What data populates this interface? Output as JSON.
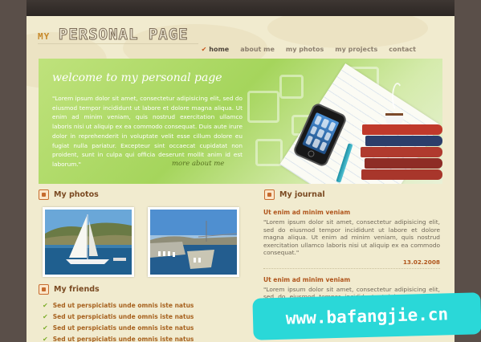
{
  "site": {
    "logo_small": "MY",
    "logo_main": "PERSONAL PAGE"
  },
  "nav": {
    "items": [
      "home",
      "about me",
      "my photos",
      "my projects",
      "contact"
    ],
    "active": "home"
  },
  "hero": {
    "title": "welcome to my personal page",
    "text": "\"Lorem ipsum dolor sit amet, consectetur adipisicing elit, sed do eiusmod tempor incididunt ut labore et dolore magna aliqua. Ut enim ad minim veniam, quis nostrud exercitation ullamco laboris nisi ut aliquip ex ea commodo consequat. Duis aute irure dolor in reprehenderit in voluptate velit esse cillum dolore eu fugiat nulla pariatur. Excepteur sint occaecat cupidatat non proident, sunt in culpa qui officia deserunt mollit anim id est laborum.\"",
    "more_link": "more about me"
  },
  "photos": {
    "title": "My photos"
  },
  "friends": {
    "title": "My friends",
    "items": [
      "Sed ut perspiciatis unde omnis iste natus",
      "Sed ut perspiciatis unde omnis iste natus",
      "Sed ut perspiciatis unde omnis iste natus",
      "Sed ut perspiciatis unde omnis iste natus"
    ]
  },
  "journal": {
    "title": "My journal",
    "entries": [
      {
        "title": "Ut enim ad minim veniam",
        "body": "\"Lorem ipsum dolor sit amet, consectetur adipisicing elit, sed do eiusmod tempor incididunt ut labore et dolore magna aliqua. Ut enim ad minim veniam, quis nostrud exercitation ullamco laboris nisi ut aliquip ex ea commodo consequat.\"",
        "date": "13.02.2008"
      },
      {
        "title": "Ut enim ad minim veniam",
        "body": "\"Lorem ipsum dolor sit amet, consectetur adipisicing elit, sed do eiusmod tempor incididunt ut labore et dolore magna aliqua. Ut enim ad minim veniam, quis nostrud exercitation ullamco laboris nisi ut aliquip ex ea commodo consequat.\""
      }
    ]
  },
  "watermark": "www.bafangjie.cn",
  "colors": {
    "accent": "#b0561d",
    "hero_green": "#a5d55c",
    "page_bg": "#f1ebcf"
  }
}
